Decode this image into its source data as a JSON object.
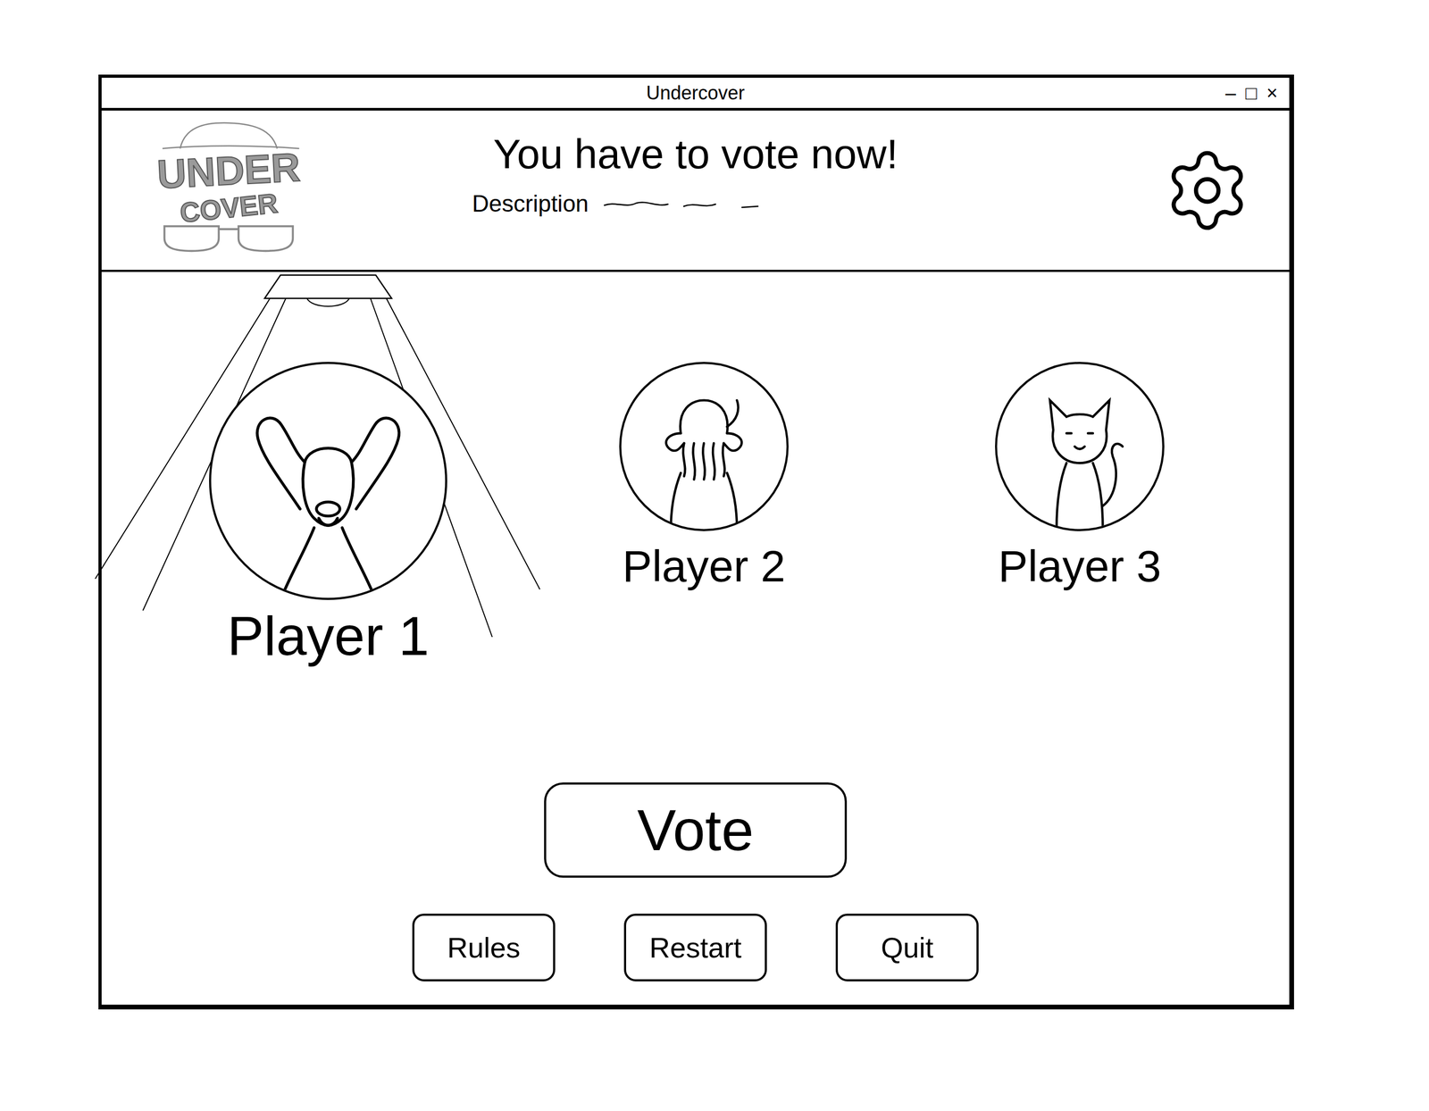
{
  "window": {
    "title": "Undercover",
    "controls": [
      "–",
      "□",
      "×"
    ]
  },
  "logo": {
    "lines": [
      "UNDER",
      "COVER"
    ]
  },
  "header": {
    "title": "You have to vote now!",
    "description": "Description"
  },
  "players": [
    {
      "name": "Player 1",
      "selected": true
    },
    {
      "name": "Player 2",
      "selected": false
    },
    {
      "name": "Player 3",
      "selected": false
    }
  ],
  "vote_button": "Vote",
  "buttons": [
    "Rules",
    "Restart",
    "Quit"
  ]
}
